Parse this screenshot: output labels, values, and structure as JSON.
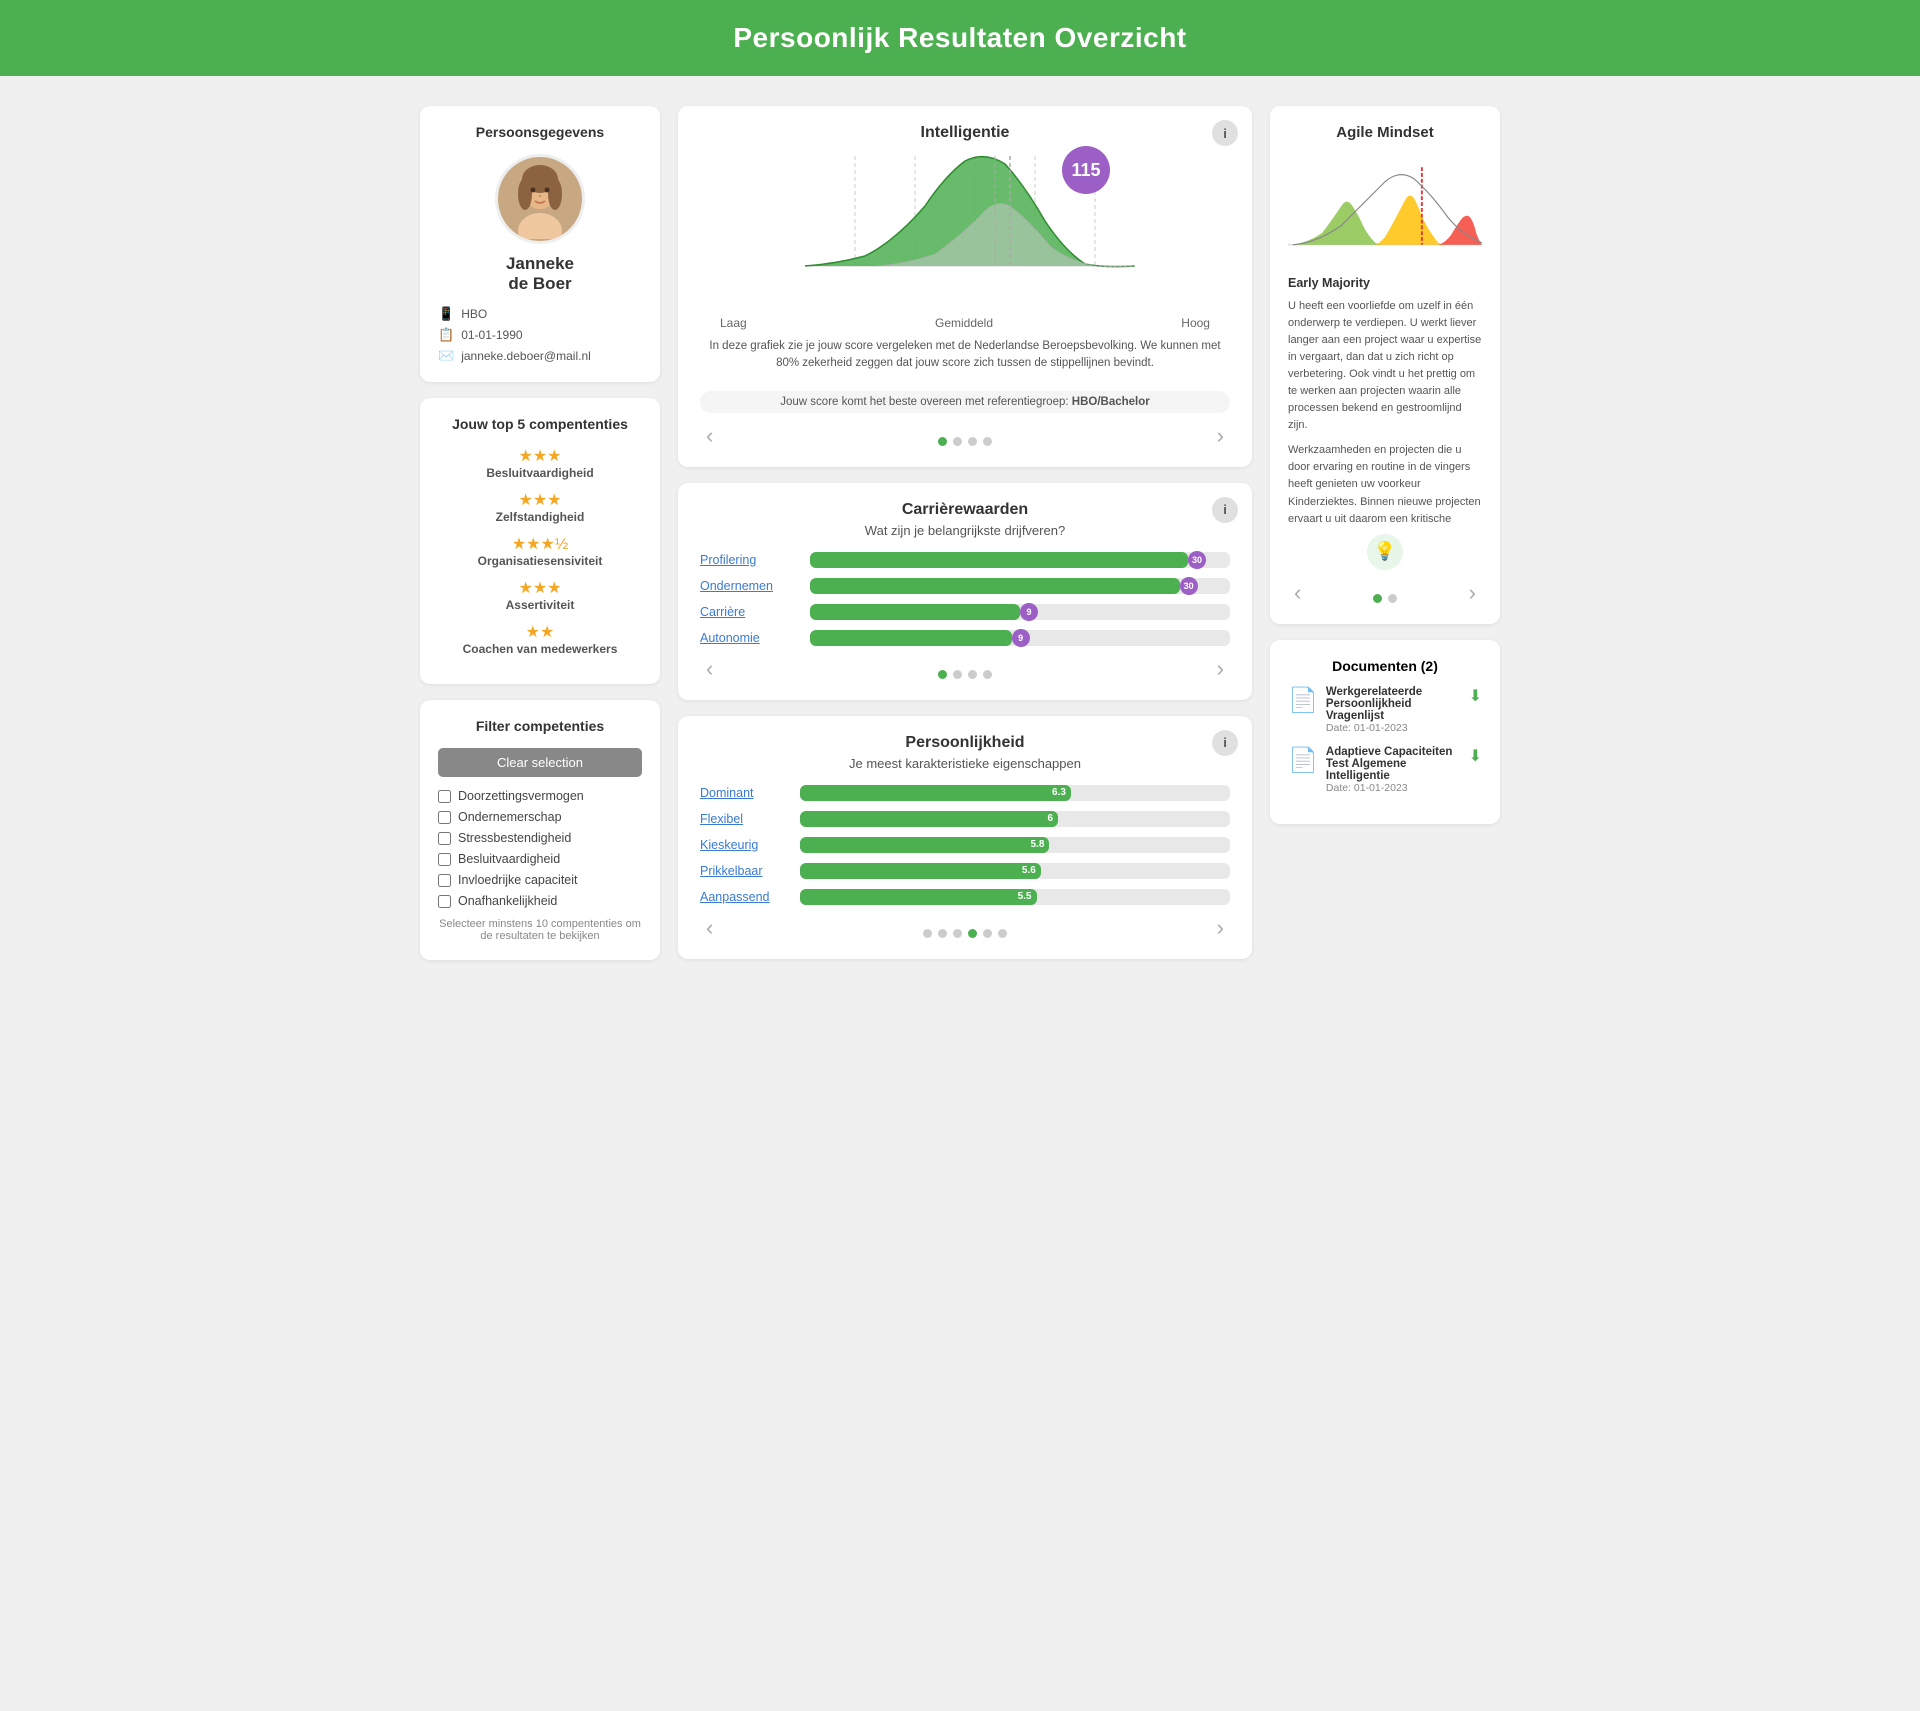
{
  "header": {
    "title": "Persoonlijk Resultaten Overzicht"
  },
  "person": {
    "name": "Janneke\nde Boer",
    "name_line1": "Janneke",
    "name_line2": "de Boer",
    "education": "HBO",
    "dob": "01-01-1990",
    "email": "janneke.deboer@mail.nl"
  },
  "top5": {
    "title": "Jouw top 5 compententies",
    "items": [
      {
        "label": "Besluitvaardigheid",
        "stars": 3
      },
      {
        "label": "Zelfstandigheid",
        "stars": 3
      },
      {
        "label": "Organisatiesensiviteit",
        "stars": 3.5
      },
      {
        "label": "Assertiviteit",
        "stars": 3
      },
      {
        "label": "Coachen van medewerkers",
        "stars": 2
      }
    ]
  },
  "filter": {
    "title": "Filter competenties",
    "clear_label": "Clear selection",
    "items": [
      "Doorzettingsvermogen",
      "Ondernemerschap",
      "Stressbestendigheid",
      "Besluitvaardigheid",
      "Invloedrijke capaciteit",
      "Onafhankelijkheid"
    ],
    "hint": "Selecteer minstens 10 compententies om de resultaten te bekijken"
  },
  "intelligence": {
    "title": "Intelligentie",
    "score": "115",
    "desc": "In deze grafiek zie je jouw score vergeleken met de Nederlandse Beroepsbevolking. We kunnen met 80% zekerheid zeggen dat jouw score zich tussen de stippellijnen bevindt.",
    "ref_label": "Jouw score komt het beste overeen met referentiegroep:",
    "ref_value": "HBO/Bachelor",
    "axis_labels": [
      "Laag",
      "Gemiddeld",
      "Hoog"
    ],
    "dots": [
      true,
      false,
      false,
      false
    ]
  },
  "career": {
    "title": "Carrièrewaarden",
    "subtitle": "Wat zijn je belangrijkste drijfveren?",
    "bars": [
      {
        "label": "Profilering",
        "value": 30,
        "max": 35,
        "pct": 90
      },
      {
        "label": "Ondernemen",
        "value": 30,
        "max": 35,
        "pct": 88
      },
      {
        "label": "Carrière",
        "value": 9,
        "max": 35,
        "pct": 50
      },
      {
        "label": "Autonomie",
        "value": 9,
        "max": 35,
        "pct": 48
      }
    ],
    "dots": [
      true,
      false,
      false,
      false
    ]
  },
  "personality": {
    "title": "Persoonlijkheid",
    "subtitle": "Je meest karakteristieke eigenschappen",
    "bars": [
      {
        "label": "Dominant",
        "value": 6.3,
        "pct": 63
      },
      {
        "label": "Flexibel",
        "value": 6.0,
        "pct": 60
      },
      {
        "label": "Kieskeurig",
        "value": 5.8,
        "pct": 58
      },
      {
        "label": "Prikkelbaar",
        "value": 5.6,
        "pct": 56
      },
      {
        "label": "Aanpassend",
        "value": 5.5,
        "pct": 55
      }
    ],
    "dots": [
      false,
      false,
      false,
      true,
      false,
      false
    ]
  },
  "agile": {
    "title": "Agile Mindset",
    "segment": "Early Majority",
    "desc1": "U heeft een voorliefde om uzelf in één onderwerp te verdiepen. U werkt liever langer aan een project waar u expertise in vergaart, dan dat u zich richt op verbetering. Ook vindt u het prettig om te werken aan projecten waarin alle processen bekend en gestroomlijnd zijn.",
    "desc2": "Werkzaamheden en projecten die u door ervaring en routine in de vingers heeft genieten uw voorkeur Kinderziektes. Binnen nieuwe projecten ervaart u uit daarom een kritische",
    "dots": [
      true,
      false
    ]
  },
  "documents": {
    "title": "Documenten (2)",
    "items": [
      {
        "name": "Werkgerelateerde Persoonlijkheid Vragenlijst",
        "date": "Date: 01-01-2023"
      },
      {
        "name": "Adaptieve Capaciteiten Test Algemene Intelligentie",
        "date": "Date: 01-01-2023"
      }
    ]
  }
}
